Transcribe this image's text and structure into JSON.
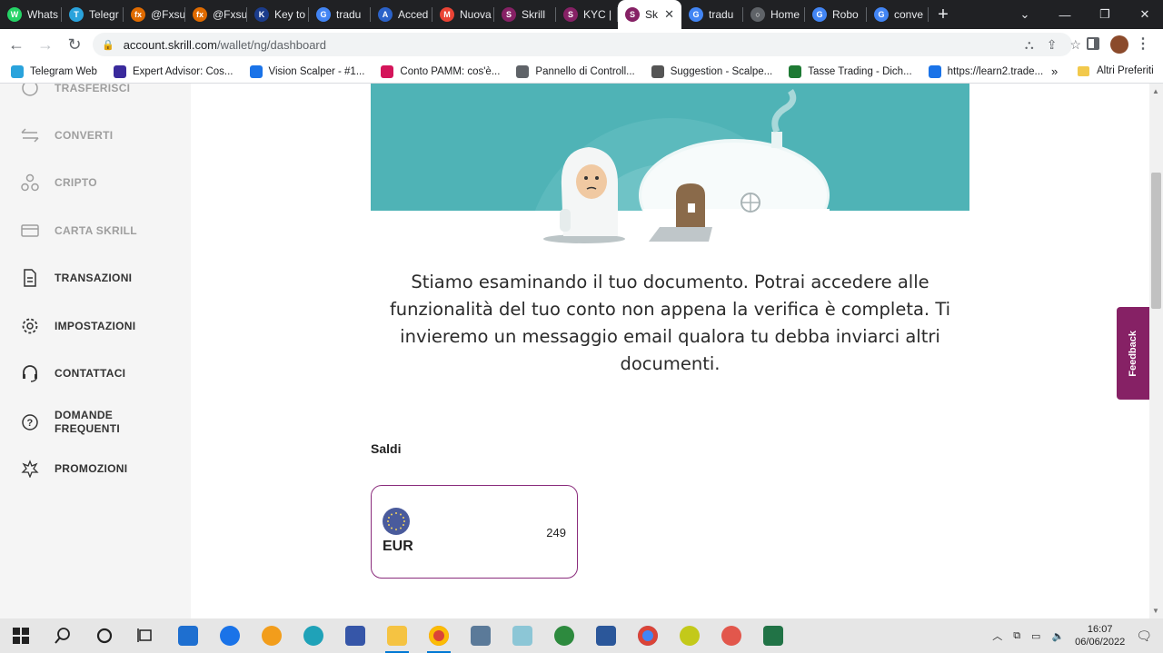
{
  "browser": {
    "tabs": [
      {
        "label": "Whats",
        "color": "#25d366",
        "glyph": "W"
      },
      {
        "label": "Telegr",
        "color": "#2aa3dc",
        "glyph": "T"
      },
      {
        "label": "@Fxsu",
        "color": "#e06b00",
        "glyph": "fx"
      },
      {
        "label": "@Fxsu",
        "color": "#e06b00",
        "glyph": "fx"
      },
      {
        "label": "Key to",
        "color": "#1b3c8c",
        "glyph": "K"
      },
      {
        "label": "tradu",
        "color": "#4285f4",
        "glyph": "G"
      },
      {
        "label": "Acced",
        "color": "#2b62c9",
        "glyph": "A"
      },
      {
        "label": "Nuova",
        "color": "#ea4335",
        "glyph": "M"
      },
      {
        "label": "Skrill",
        "color": "#862165",
        "glyph": "S"
      },
      {
        "label": "KYC |",
        "color": "#862165",
        "glyph": "S"
      },
      {
        "label": "Sk",
        "color": "#862165",
        "glyph": "S",
        "active": true
      },
      {
        "label": "tradu",
        "color": "#4285f4",
        "glyph": "G"
      },
      {
        "label": "Home",
        "color": "#5f6368",
        "glyph": "○"
      },
      {
        "label": "Robo",
        "color": "#4285f4",
        "glyph": "G"
      },
      {
        "label": "conve",
        "color": "#4285f4",
        "glyph": "G"
      }
    ],
    "url_host": "account.skrill.com",
    "url_path": "/wallet/ng/dashboard",
    "bookmarks": [
      {
        "label": "Telegram Web",
        "color": "#2aa3dc"
      },
      {
        "label": "Expert Advisor: Cos...",
        "color": "#3a2a9c"
      },
      {
        "label": "Vision Scalper - #1...",
        "color": "#1a73e8"
      },
      {
        "label": "Conto PAMM: cos'è...",
        "color": "#d4145a"
      },
      {
        "label": "Pannello di Controll...",
        "color": "#5f6368"
      },
      {
        "label": "Suggestion - Scalpe...",
        "color": "#555555"
      },
      {
        "label": "Tasse Trading - Dich...",
        "color": "#1e7a34"
      },
      {
        "label": "https://learn2.trade...",
        "color": "#1a73e8"
      }
    ],
    "bookmarks_more": "»",
    "other_bookmarks": "Altri Preferiti"
  },
  "sidebar": {
    "items": [
      {
        "label": "TRASFERISCI",
        "icon": "transfer-icon",
        "state": "dim"
      },
      {
        "label": "CONVERTI",
        "icon": "convert-icon",
        "state": "dim"
      },
      {
        "label": "CRIPTO",
        "icon": "crypto-icon",
        "state": "dim"
      },
      {
        "label": "CARTA SKRILL",
        "icon": "card-icon",
        "state": "dim"
      },
      {
        "label": "TRANSAZIONI",
        "icon": "document-icon",
        "state": "dark"
      },
      {
        "label": "IMPOSTAZIONI",
        "icon": "gear-icon",
        "state": "dark"
      },
      {
        "label": "CONTATTACI",
        "icon": "headset-icon",
        "state": "dark"
      },
      {
        "label": "DOMANDE",
        "label2": "FREQUENTI",
        "icon": "help-icon",
        "state": "dark"
      },
      {
        "label": "PROMOZIONI",
        "icon": "promo-icon",
        "state": "dark"
      }
    ]
  },
  "main": {
    "message": "Stiamo esaminando il tuo documento. Potrai accedere alle funzionalità del tuo conto non appena la verifica è completa. Ti invieremo un messaggio email qualora tu debba inviarci altri documenti.",
    "balances_title": "Saldi",
    "balance": {
      "currency": "EUR",
      "amount": "249"
    }
  },
  "feedback": "Feedback",
  "taskbar": {
    "time": "16:07",
    "date": "06/06/2022"
  },
  "colors": {
    "brand": "#862165",
    "hero_teal": "#4fb3b6"
  }
}
